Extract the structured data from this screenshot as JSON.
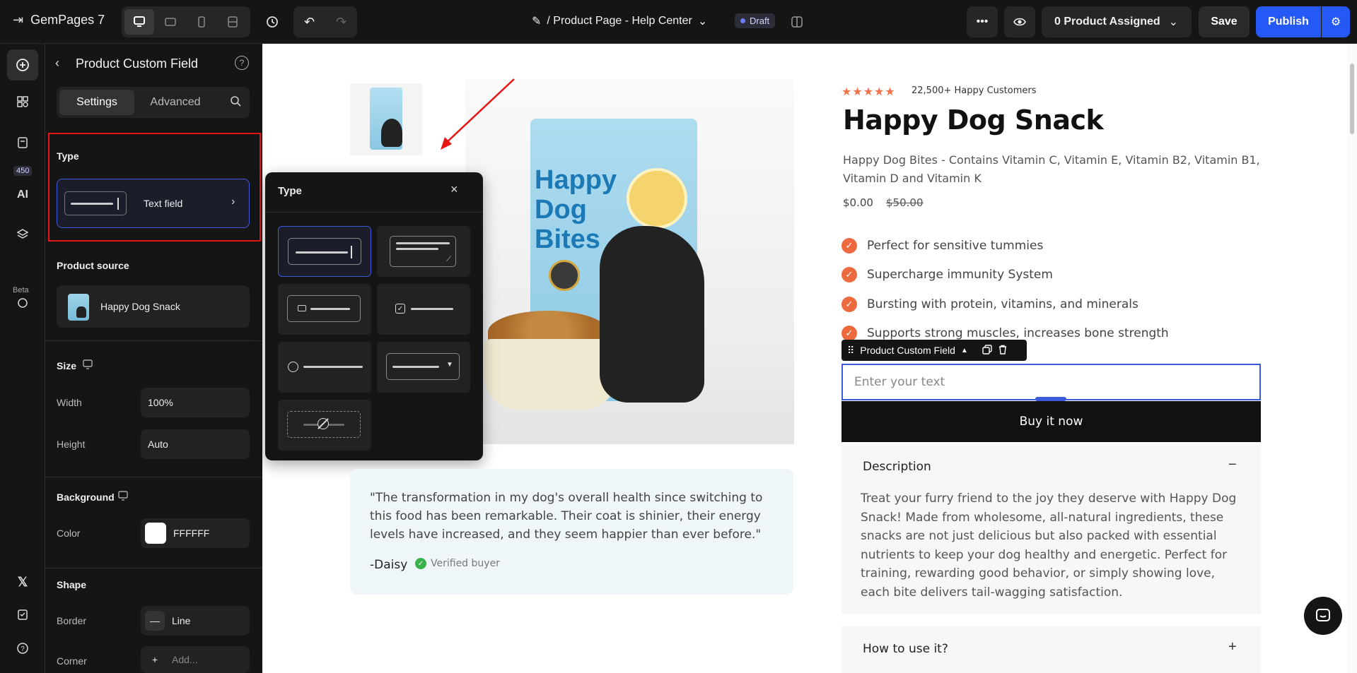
{
  "topbar": {
    "app_name": "GemPages 7",
    "page_title": "/ Product Page - Help Center",
    "draft_label": "Draft",
    "product_assigned": "0 Product Assigned",
    "save_label": "Save",
    "publish_label": "Publish"
  },
  "rail": {
    "badge_count": "450",
    "beta_label": "Beta",
    "ai_label": "AI"
  },
  "panel": {
    "title": "Product Custom Field",
    "tabs": [
      {
        "label": "Settings",
        "active": true
      },
      {
        "label": "Advanced",
        "active": false
      }
    ],
    "type_section": "Type",
    "type_value": "Text field",
    "product_source_label": "Product source",
    "product_source_value": "Happy Dog Snack",
    "size_label": "Size",
    "width_label": "Width",
    "width_value": "100%",
    "height_label": "Height",
    "height_value": "Auto",
    "background_label": "Background",
    "color_label": "Color",
    "color_value": "FFFFFF",
    "shape_label": "Shape",
    "border_label": "Border",
    "border_value": "Line",
    "corner_label": "Corner",
    "corner_placeholder": "Add..."
  },
  "popover": {
    "title": "Type",
    "options": [
      "text-field",
      "textarea",
      "email",
      "checkbox",
      "radio",
      "dropdown",
      "hidden"
    ],
    "selected": "text-field"
  },
  "product": {
    "stars": "★★★★★",
    "happy_customers": "22,500+ Happy Customers",
    "title": "Happy Dog Snack",
    "description": "Happy Dog Bites - Contains Vitamin C, Vitamin E, Vitamin B2, Vitamin B1, Vitamin D and Vitamin K",
    "price": "$0.00",
    "compare_price": "$50.00",
    "features": [
      "Perfect for sensitive tummies",
      "Supercharge immunity System",
      "Bursting with protein, vitamins, and minerals",
      "Supports strong muscles, increases bone strength"
    ],
    "custom_field_tag": "Product Custom Field",
    "custom_field_placeholder": "Enter your text",
    "buy_label": "Buy it now",
    "accordion": [
      {
        "title": "Description",
        "expanded": true,
        "body": "Treat your furry friend to the joy they deserve with Happy Dog Snack! Made from wholesome, all-natural ingredients, these snacks are not just delicious but also packed with essential nutrients to keep your dog healthy and energetic. Perfect for training, rewarding good behavior, or simply showing love, each bite delivers tail-wagging satisfaction."
      },
      {
        "title": "How to use it?",
        "expanded": false,
        "body": ""
      }
    ],
    "bag_text": "Happy Dog Bites",
    "review": {
      "quote": "\"The transformation in my dog's overall health since switching to this food has been remarkable. Their coat is shinier, their energy levels have increased, and they seem happier than ever before.\"",
      "author": "-Daisy",
      "verified": "Verified buyer"
    }
  },
  "colors": {
    "accent": "#2459f5",
    "highlight": "#e51616",
    "feature_tick": "#ed6a3e"
  }
}
